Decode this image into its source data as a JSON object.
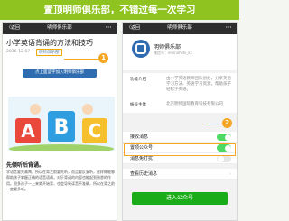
{
  "banner": {
    "text": "置顶明师俱乐部，不错过每一次学习"
  },
  "left": {
    "nav": {
      "back": "〈返回",
      "title": "明师俱乐部",
      "more": "···"
    },
    "article": {
      "title": "小学英语背诵的方法和技巧",
      "date": "2016-12-07",
      "account_link": "明师俱乐部",
      "badge": "1",
      "hint": "点上面蓝字加入明师俱乐部",
      "hero_letters": [
        "A",
        "B",
        "C"
      ],
      "section_title": "先倾听后背诵。",
      "paragraph": "学语言要先熏陶，所以在背之前要先听，而且要反复听，这样做能够帮助孩子掌握正确的语音语调，对于背诵的内容也能起到熟悉的作用。很多孩子一上来就开始背，也会导致读音不准确，所以在背之前一定要多听。"
    }
  },
  "right": {
    "nav": {
      "back": "〈返回",
      "title": "明师俱乐部",
      "more": "···"
    },
    "profile": {
      "name": "明师俱乐部",
      "id": "微信号：ensnimshi_kk"
    },
    "info": {
      "intro_key": "功能介绍",
      "intro_val": "由小学英语教师团队创办，分享英语学习方法、英语学习资源，帮助孩子轻松学英语。",
      "account_key": "帐号主体",
      "account_val": "北京明师国际教育科技有限公司"
    },
    "settings": {
      "receive": "接收消息",
      "pin": "置顶公众号",
      "badge": "2",
      "notify": "消息免打扰",
      "history": "查看历史消息"
    },
    "enter_button": "进入公众号"
  },
  "colors": {
    "accent": "#8fc31f",
    "badge": "#f5a623",
    "brand_blue": "#2f6db0",
    "wechat_green": "#1aad19"
  }
}
